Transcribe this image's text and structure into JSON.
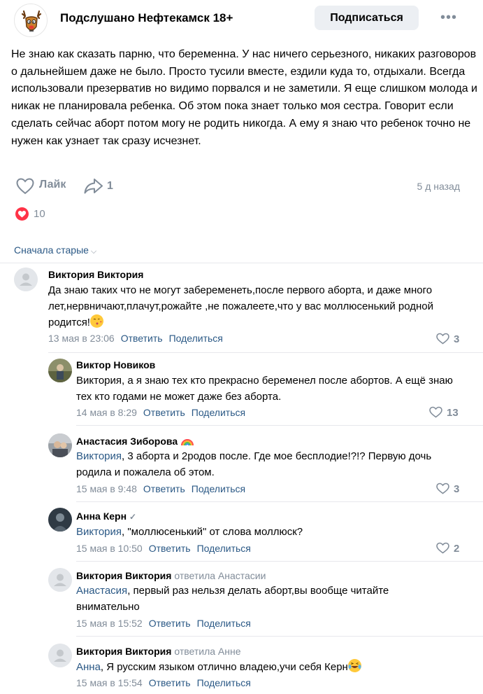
{
  "group": {
    "name": "Подслушано Нефтекамск 18+",
    "subscribe_label": "Подписаться",
    "more_icon": "more-horizontal-icon"
  },
  "post": {
    "text": "Не знаю как сказать парню, что беременна. У нас ничего серьезного, никаких разговоров о дальнейшем даже не было. Просто тусили вместе, ездили куда то, отдыхали. Всегда использовали презерватив но видимо порвался и не заметили. Я еще слишком молода и никак не планировала ребенка. Об этом пока знает только моя сестра. Говорит если сделать сейчас аборт потом могу не родить никогда. А ему я знаю что ребенок точно не нужен как узнает так сразу исчезнет.",
    "like_label": "Лайк",
    "share_count": "1",
    "date": "5 д назад",
    "reaction_count": "10"
  },
  "comments_sort": "Сначала старые",
  "colors": {
    "link": "#2a5885",
    "muted": "#818c99",
    "heart": "#ff3347"
  },
  "comments": [
    {
      "author": "Виктория Виктория",
      "reply_to": "",
      "mention": "",
      "text": "Да знаю таких что не могут забеременеть,после первого аборта, и даже много лет,нервничают,плачут,рожайте ,не пожалеете,что у вас моллюсенький родной родится!",
      "date": "13 мая в 23:06",
      "reply_label": "Ответить",
      "share_label": "Поделиться",
      "likes": "3"
    },
    {
      "author": "Виктор Новиков",
      "reply_to": "",
      "mention": "",
      "text": "Виктория, а я знаю тех кто прекрасно беременел после абортов. А ещё знаю тех кто годами не может даже без аборта.",
      "date": "14 мая в 8:29",
      "reply_label": "Ответить",
      "share_label": "Поделиться",
      "likes": "13"
    },
    {
      "author": "Анастасия Зиборова",
      "reply_to": "",
      "mention": "Виктория",
      "text": ", 3 аборта и 2родов после. Где мое бесплодие!?!? Первую дочь родила и пожалела об этом.",
      "date": "15 мая в 9:48",
      "reply_label": "Ответить",
      "share_label": "Поделиться",
      "likes": "3"
    },
    {
      "author": "Анна Керн",
      "reply_to": "",
      "mention": "Виктория",
      "text": ", \"моллюсенький\" от слова моллюск?",
      "date": "15 мая в 10:50",
      "reply_label": "Ответить",
      "share_label": "Поделиться",
      "likes": "2"
    },
    {
      "author": "Виктория Виктория",
      "reply_to": "ответила Анастасии",
      "mention": "Анастасия",
      "text": ", первый раз нельзя делать аборт,вы вообще читайте внимательно",
      "date": "15 мая в 15:52",
      "reply_label": "Ответить",
      "share_label": "Поделиться",
      "likes": ""
    },
    {
      "author": "Виктория Виктория",
      "reply_to": "ответила Анне",
      "mention": "Анна",
      "text": ", Я русским языком отлично владею,учи себя Керн",
      "date": "15 мая в 15:54",
      "reply_label": "Ответить",
      "share_label": "Поделиться",
      "likes": ""
    }
  ]
}
